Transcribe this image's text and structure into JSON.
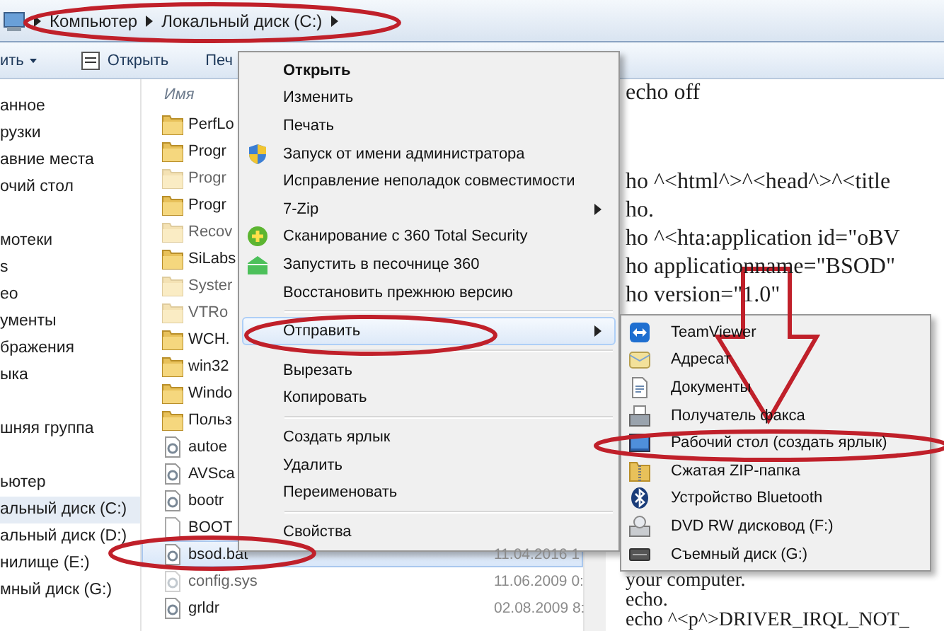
{
  "address_bar": {
    "crumbs": [
      "Компьютер",
      "Локальный диск (C:)"
    ]
  },
  "toolbar": {
    "items": [
      {
        "label": "ить",
        "kind": "dropdown"
      },
      {
        "label": "Открыть",
        "kind": "open"
      },
      {
        "label": "Печ",
        "kind": "plain"
      }
    ]
  },
  "nav": {
    "groups": [
      {
        "items": [
          {
            "label": "анное",
            "selected": false
          },
          {
            "label": "рузки",
            "selected": false
          },
          {
            "label": "авние места",
            "selected": false
          },
          {
            "label": "очий стол",
            "selected": false
          }
        ]
      },
      {
        "items": [
          {
            "label": "мотеки",
            "selected": false
          },
          {
            "label": "s",
            "selected": false
          },
          {
            "label": "ео",
            "selected": false
          },
          {
            "label": "ументы",
            "selected": false
          },
          {
            "label": "бражения",
            "selected": false
          },
          {
            "label": "ыка",
            "selected": false
          }
        ]
      },
      {
        "items": [
          {
            "label": "шняя группа",
            "selected": false
          }
        ]
      },
      {
        "items": [
          {
            "label": "ьютер",
            "selected": false
          },
          {
            "label": "альный диск (C:)",
            "selected": true
          },
          {
            "label": "альный диск (D:)",
            "selected": false
          },
          {
            "label": "нилище (E:)",
            "selected": false
          },
          {
            "label": "мный диск (G:)",
            "selected": false
          }
        ]
      }
    ]
  },
  "files": {
    "column_header": "Имя",
    "rows": [
      {
        "name": "PerfLo",
        "kind": "folder",
        "faded": false,
        "selected": false
      },
      {
        "name": "Progr",
        "kind": "folder",
        "faded": false,
        "selected": false
      },
      {
        "name": "Progr",
        "kind": "folder",
        "faded": true,
        "selected": false
      },
      {
        "name": "Progr",
        "kind": "folder",
        "faded": false,
        "selected": false
      },
      {
        "name": "Recov",
        "kind": "folder",
        "faded": true,
        "selected": false
      },
      {
        "name": "SiLabs",
        "kind": "folder",
        "faded": false,
        "selected": false
      },
      {
        "name": "Syster",
        "kind": "folder",
        "faded": true,
        "selected": false
      },
      {
        "name": "VTRo",
        "kind": "folder",
        "faded": true,
        "selected": false
      },
      {
        "name": "WCH.",
        "kind": "folder",
        "faded": false,
        "selected": false
      },
      {
        "name": "win32",
        "kind": "folder",
        "faded": false,
        "selected": false
      },
      {
        "name": "Windo",
        "kind": "folder",
        "faded": false,
        "selected": false
      },
      {
        "name": "Польз",
        "kind": "folder",
        "faded": false,
        "selected": false
      },
      {
        "name": "autoe",
        "kind": "file",
        "faded": false,
        "selected": false
      },
      {
        "name": "AVSca",
        "kind": "file",
        "faded": false,
        "selected": false
      },
      {
        "name": "bootr",
        "kind": "file",
        "faded": false,
        "selected": false
      },
      {
        "name": "BOOT",
        "kind": "blank",
        "faded": false,
        "selected": false
      },
      {
        "name": "bsod.bat",
        "kind": "file",
        "faded": false,
        "selected": true,
        "date": "11.04.2016 1"
      },
      {
        "name": "config.sys",
        "kind": "file",
        "faded": true,
        "selected": false,
        "date": "11.06.2009 0:"
      },
      {
        "name": "grldr",
        "kind": "file",
        "faded": false,
        "selected": false,
        "date": "02.08.2009 8:"
      }
    ]
  },
  "notepad": {
    "groups": [
      [
        "echo off"
      ],
      [
        "ho ^<html^>^<head^>^<title",
        "ho.",
        "ho ^<hta:application id=\"oBV",
        "ho applicationname=\"BSOD\"",
        "ho version=\"1.0\""
      ]
    ],
    "bottom_lines": [
      "your computer.",
      "echo.",
      "echo ^<p^>DRIVER_IRQL_NOT_"
    ]
  },
  "context_menu": {
    "items": [
      {
        "kind": "item",
        "label": "Открыть",
        "default": true,
        "submenu": false,
        "selected": false
      },
      {
        "kind": "item",
        "label": "Изменить",
        "default": false,
        "submenu": false,
        "selected": false
      },
      {
        "kind": "item",
        "label": "Печать",
        "default": false,
        "submenu": false,
        "selected": false
      },
      {
        "kind": "shield",
        "label": "Запуск от имени администратора",
        "default": false,
        "submenu": false,
        "selected": false
      },
      {
        "kind": "item",
        "label": "Исправление неполадок совместимости",
        "default": false,
        "submenu": false,
        "selected": false
      },
      {
        "kind": "item",
        "label": "7-Zip",
        "default": false,
        "submenu": true,
        "selected": false
      },
      {
        "kind": "scan",
        "label": "Сканирование с 360 Total Security",
        "default": false,
        "submenu": false,
        "selected": false
      },
      {
        "kind": "sandbox",
        "label": "Запустить в песочнице 360",
        "default": false,
        "submenu": false,
        "selected": false
      },
      {
        "kind": "item",
        "label": "Восстановить прежнюю версию",
        "default": false,
        "submenu": false,
        "selected": false
      },
      {
        "kind": "separator"
      },
      {
        "kind": "item",
        "label": "Отправить",
        "default": false,
        "submenu": true,
        "selected": true
      },
      {
        "kind": "separator"
      },
      {
        "kind": "item",
        "label": "Вырезать",
        "default": false,
        "submenu": false,
        "selected": false
      },
      {
        "kind": "item",
        "label": "Копировать",
        "default": false,
        "submenu": false,
        "selected": false
      },
      {
        "kind": "separator"
      },
      {
        "kind": "item",
        "label": "Создать ярлык",
        "default": false,
        "submenu": false,
        "selected": false
      },
      {
        "kind": "item",
        "label": "Удалить",
        "default": false,
        "submenu": false,
        "selected": false
      },
      {
        "kind": "item",
        "label": "Переименовать",
        "default": false,
        "submenu": false,
        "selected": false
      },
      {
        "kind": "separator"
      },
      {
        "kind": "item",
        "label": "Свойства",
        "default": false,
        "submenu": false,
        "selected": false
      }
    ]
  },
  "submenu": {
    "items": [
      {
        "kind": "remote",
        "label": "TeamViewer",
        "selected": false
      },
      {
        "kind": "mail",
        "label": "Адресат",
        "selected": false
      },
      {
        "kind": "document",
        "label": "Документы",
        "selected": false
      },
      {
        "kind": "fax",
        "label": "Получатель факса",
        "selected": false
      },
      {
        "kind": "desktop",
        "label": "Рабочий стол (создать ярлык)",
        "selected": false
      },
      {
        "kind": "zip",
        "label": "Сжатая ZIP-папка",
        "selected": false
      },
      {
        "kind": "bluetooth",
        "label": "Устройство Bluetooth",
        "selected": false
      },
      {
        "kind": "dvd",
        "label": "DVD RW дисковод (F:)",
        "selected": false
      },
      {
        "kind": "drive",
        "label": "Съемный диск (G:)",
        "selected": false
      }
    ]
  }
}
